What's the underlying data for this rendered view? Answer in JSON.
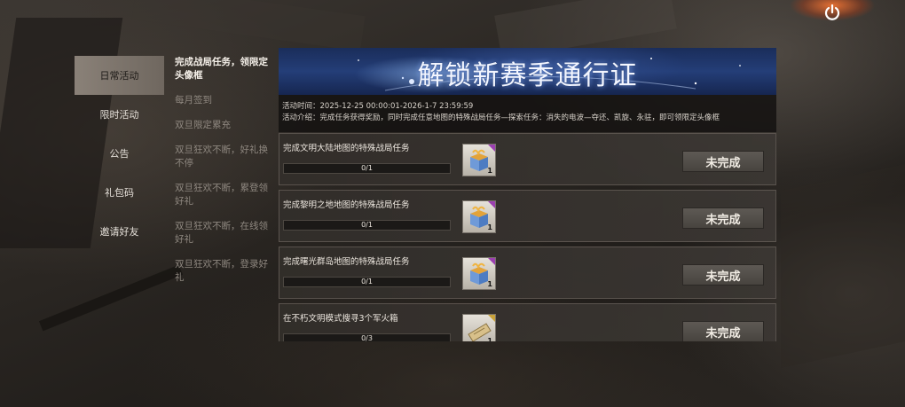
{
  "left_nav": {
    "items": [
      {
        "label": "日常活动",
        "active": true
      },
      {
        "label": "限时活动",
        "active": false
      },
      {
        "label": "公告",
        "active": false
      },
      {
        "label": "礼包码",
        "active": false
      },
      {
        "label": "邀请好友",
        "active": false
      }
    ]
  },
  "sub_nav": {
    "items": [
      {
        "label": "完成战局任务，领限定头像框",
        "active": true
      },
      {
        "label": "每月签到",
        "active": false
      },
      {
        "label": "双旦限定累充",
        "active": false
      },
      {
        "label": "双旦狂欢不断，好礼换不停",
        "active": false
      },
      {
        "label": "双旦狂欢不断，累登领好礼",
        "active": false
      },
      {
        "label": "双旦狂欢不断，在线领好礼",
        "active": false
      },
      {
        "label": "双旦狂欢不断，登录好礼",
        "active": false
      }
    ]
  },
  "banner": {
    "title": "解锁新赛季通行证"
  },
  "info": {
    "time": "活动时间：2025-12-25 00:00:01-2026-1-7 23:59:59",
    "description": "活动介绍：完成任务获得奖励，同时完成任意地图的特殊战局任务—探索任务：消失的电波—夺还、凯旋、永驻，即可领限定头像框"
  },
  "tasks": [
    {
      "title": "完成文明大陆地图的特殊战局任务",
      "progress_text": "0/1",
      "progress": 0,
      "reward_icon": "supply-box-icon",
      "reward_qty": "1",
      "status": "未完成"
    },
    {
      "title": "完成黎明之地地图的特殊战局任务",
      "progress_text": "0/1",
      "progress": 0,
      "reward_icon": "supply-box-icon",
      "reward_qty": "1",
      "status": "未完成"
    },
    {
      "title": "完成曙光群岛地图的特殊战局任务",
      "progress_text": "0/1",
      "progress": 0,
      "reward_icon": "supply-box-icon",
      "reward_qty": "1",
      "status": "未完成"
    },
    {
      "title": "在不朽文明模式搜寻3个军火箱",
      "progress_text": "0/3",
      "progress": 0,
      "reward_icon": "ticket-icon",
      "reward_qty": "1",
      "status": "未完成"
    }
  ],
  "colors": {
    "accent_purple": "#9b3fb0",
    "accent_gold": "#c9a23a",
    "banner_blue": "#243e78"
  }
}
